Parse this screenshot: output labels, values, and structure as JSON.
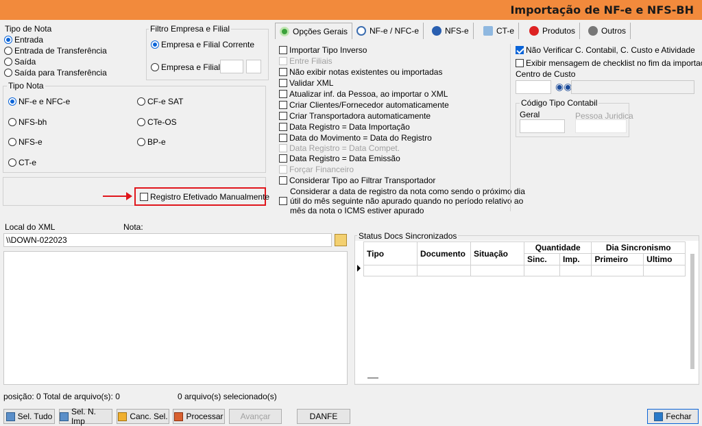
{
  "title": "Importação de NF-e e NFS-BH",
  "tipo_de_nota": {
    "title": "Tipo de Nota",
    "options": [
      "Entrada",
      "Entrada de Transferência",
      "Saída",
      "Saída para Transferência"
    ],
    "selected": "Entrada"
  },
  "filtro": {
    "title": "Filtro Empresa e Filial",
    "option1": "Empresa e Filial Corrente",
    "option2": "Empresa e Filial :"
  },
  "tipo_nota2": {
    "title": "Tipo Nota",
    "options": [
      "NF-e e NFC-e",
      "NFS-bh",
      "NFS-e",
      "CT-e",
      "CF-e SAT",
      "CTe-OS",
      "BP-e"
    ]
  },
  "registro_manual": "Registro Efetivado Manualmente",
  "tabs": [
    "Opções Gerais",
    "NF-e / NFC-e",
    "NFS-e",
    "CT-e",
    "Produtos",
    "Outros"
  ],
  "opcoes": [
    "Importar Tipo Inverso",
    "Entre Filiais",
    "Não exibir notas existentes ou importadas",
    "Validar XML",
    "Atualizar inf. da Pessoa, ao importar o XML",
    "Criar Clientes/Fornecedor automaticamente",
    "Criar Transportadora automaticamente",
    "Data Registro = Data Importação",
    "Data do Movimento = Data do Registro",
    "Data Registro = Data Compet.",
    "Data Registro = Data Emissão",
    "Forçar Financeiro",
    "Considerar Tipo ao Filtrar Transportador"
  ],
  "opcao_longa": [
    "Considerar a data de registro da nota como sendo o próximo dia",
    "útil do mês seguinte não apurado quando no período relativo ao",
    "mês da nota o ICMS estiver apurado"
  ],
  "right": {
    "nao_verificar": "Não Verificar C. Contabil, C. Custo e Atividade",
    "exibir_checklist": "Exibir mensagem de checklist no fim da importação",
    "centro_custo": "Centro de Custo",
    "codigo_tipo": "Código Tipo Contabil",
    "geral": "Geral",
    "pessoa_juridica": "Pessoa Juridica"
  },
  "local_xml": {
    "label": "Local do XML",
    "nota_label": "Nota:",
    "value": "\\\\DOWN-022023"
  },
  "status": {
    "title": "Status Docs Sincronizados",
    "cols": {
      "tipo": "Tipo",
      "documento": "Documento",
      "situacao": "Situação",
      "quantidade": "Quantidade",
      "sinc": "Sinc.",
      "imp": "Imp.",
      "dia": "Dia Sincronismo",
      "primeiro": "Primeiro",
      "ultimo": "Ultimo"
    }
  },
  "footer": {
    "posicao": "posição: 0  Total de arquivo(s): 0",
    "selecionados": "0 arquivo(s) selecionado(s)"
  },
  "buttons": [
    "Sel. Tudo",
    "Sel. N. Imp",
    "Canc. Sel.",
    "Processar",
    "Avançar",
    "DANFE",
    "Fechar"
  ]
}
